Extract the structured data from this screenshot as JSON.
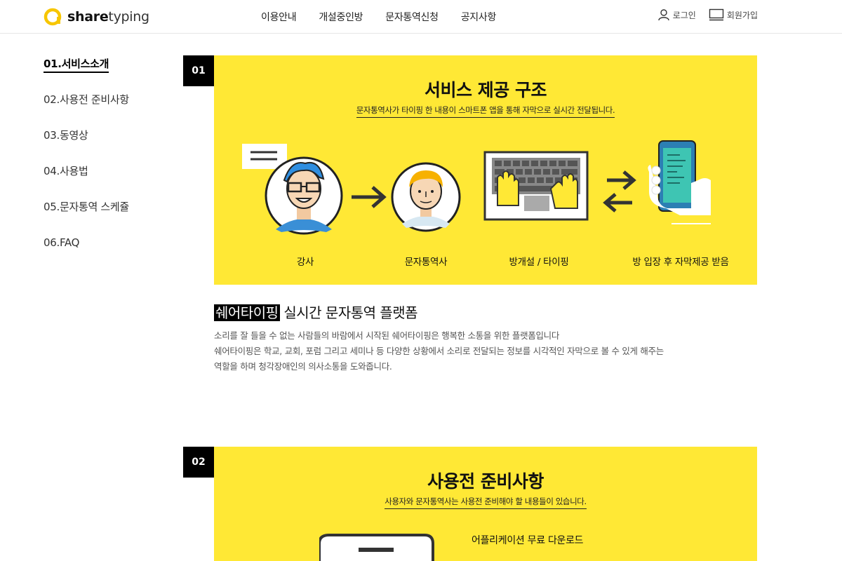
{
  "header": {
    "logo_bold": "share",
    "logo_light": "typing",
    "nav": [
      "이용안내",
      "개설중인방",
      "문자통역신청",
      "공지사항"
    ],
    "login": "로그인",
    "signup": "회원가입"
  },
  "sidebar": {
    "items": [
      {
        "label": "01.서비스소개",
        "active": true
      },
      {
        "label": "02.사용전 준비사항",
        "active": false
      },
      {
        "label": "03.동영상",
        "active": false
      },
      {
        "label": "04.사용법",
        "active": false
      },
      {
        "label": "05.문자통역 스케쥴",
        "active": false
      },
      {
        "label": "06.FAQ",
        "active": false
      }
    ]
  },
  "section1": {
    "number": "01",
    "title": "서비스 제공 구조",
    "subtitle": "문자통역사가 타이핑 한 내용이 스마트폰 앱을 통해 자막으로 실시간 전달됩니다.",
    "steps": [
      "강사",
      "문자통역사",
      "방개설 / 타이핑",
      "방 입장 후 자막제공 받음"
    ],
    "desc_highlight": "쉐어타이핑",
    "desc_title_rest": " 실시간 문자통역 플랫폼",
    "desc_lines": [
      "소리를 잘 들을 수 없는 사람들의 바람에서 시작된 쉐어타이핑은 행복한 소통을 위한 플랫폼입니다",
      "쉐어타이핑은 학교, 교회, 포럼 그리고 세미나 등 다양한 상황에서 소리로 전달되는 정보를 시각적인 자막으로 볼 수 있게 해주는",
      "역할을 하며 청각장애인의 의사소통을 도와줍니다."
    ]
  },
  "section2": {
    "number": "02",
    "title": "사용전 준비사항",
    "subtitle": "사용자와 문자통역사는 사용전 준비해야 할 내용들이 있습니다.",
    "feature_title": "어플리케이션 무료 다운로드"
  },
  "colors": {
    "brand_yellow": "#ffe835",
    "logo_yellow": "#f7c600",
    "black": "#000000"
  }
}
